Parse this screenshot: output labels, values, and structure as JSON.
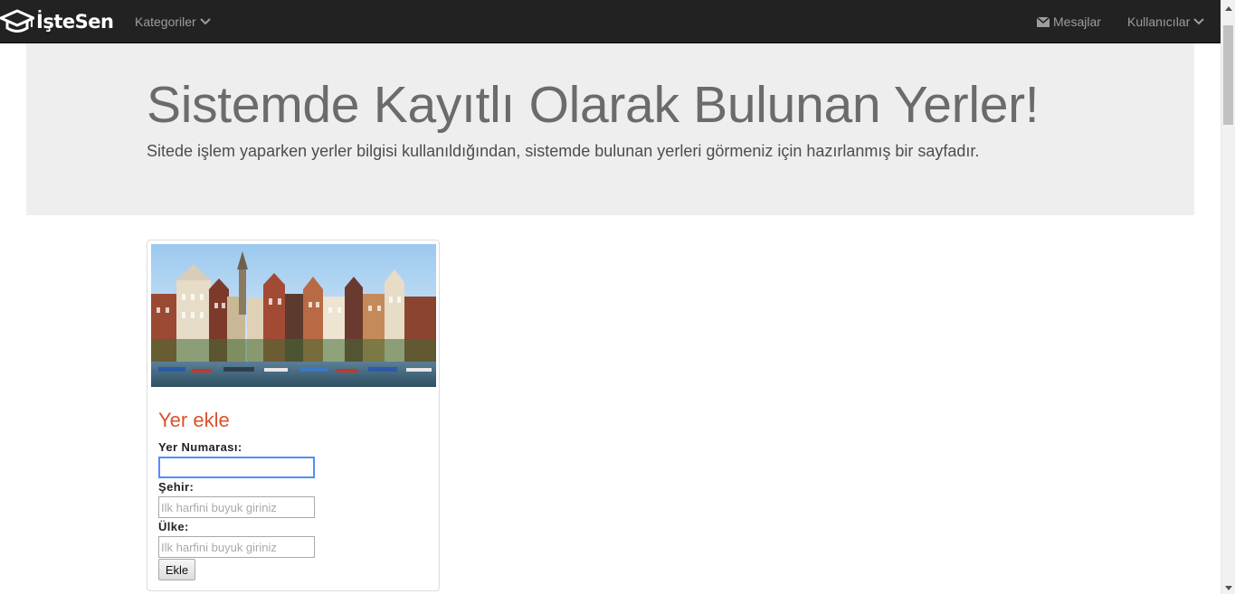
{
  "navbar": {
    "brand": "İşteSen",
    "categories_label": "Kategoriler",
    "messages_label": "Mesajlar",
    "users_label": "Kullanıcılar"
  },
  "jumbotron": {
    "title": "Sistemde Kayıtlı Olarak Bulunan Yerler!",
    "subtitle": "Sitede işlem yaparken yerler bilgisi kullanıldığından, sistemde bulunan yerleri görmeniz için hazırlanmış bir sayfadır."
  },
  "form": {
    "title": "Yer ekle",
    "place_number_label": "Yer Numarası:",
    "place_number_value": "",
    "city_label": "Şehir:",
    "city_placeholder": "Ilk harfini buyuk giriniz",
    "country_label": "Ülke:",
    "country_placeholder": "Ilk harfini buyuk giriniz",
    "submit_label": "Ekle"
  },
  "colors": {
    "navbar_bg": "#222222",
    "nav_text": "#9d9d9d",
    "jumbotron_bg": "#eeeeee",
    "form_title": "#d9532a"
  }
}
